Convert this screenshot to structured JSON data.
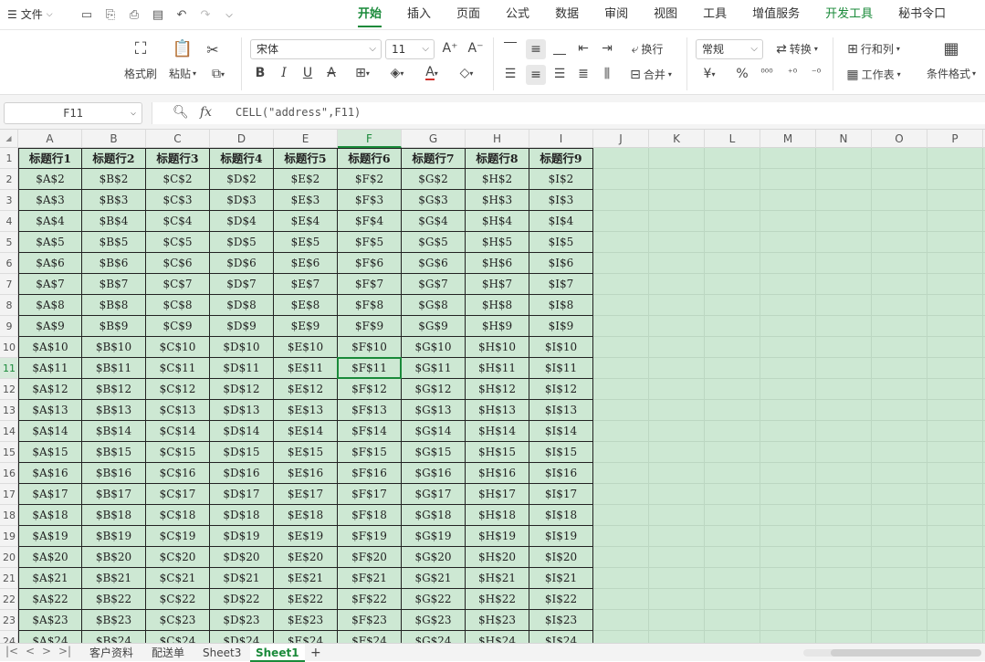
{
  "menu": {
    "file_label": "文件",
    "tabs": [
      {
        "label": "开始",
        "state": "active"
      },
      {
        "label": "插入",
        "state": ""
      },
      {
        "label": "页面",
        "state": ""
      },
      {
        "label": "公式",
        "state": ""
      },
      {
        "label": "数据",
        "state": ""
      },
      {
        "label": "审阅",
        "state": ""
      },
      {
        "label": "视图",
        "state": ""
      },
      {
        "label": "工具",
        "state": ""
      },
      {
        "label": "增值服务",
        "state": ""
      },
      {
        "label": "开发工具",
        "state": "green"
      },
      {
        "label": "秘书令口",
        "state": ""
      }
    ]
  },
  "ribbon": {
    "format_painter": "格式刷",
    "paste": "粘贴",
    "font_name": "宋体",
    "font_size": "11",
    "wrap": "换行",
    "merge": "合并",
    "number_format": "常规",
    "convert": "转换",
    "rows_cols": "行和列",
    "worksheet": "工作表",
    "conditional": "条件格式"
  },
  "formula_bar": {
    "cell_ref": "F11",
    "formula": "CELL(\"address\",F11)"
  },
  "grid": {
    "columns": [
      "A",
      "B",
      "C",
      "D",
      "E",
      "F",
      "G",
      "H",
      "I",
      "J",
      "K",
      "L",
      "M",
      "N",
      "O",
      "P"
    ],
    "selected_col": "F",
    "selected_row": 11,
    "headers": [
      "标题行1",
      "标题行2",
      "标题行3",
      "标题行4",
      "标题行5",
      "标题行6",
      "标题行7",
      "标题行8",
      "标题行9"
    ],
    "data_cols": [
      "A",
      "B",
      "C",
      "D",
      "E",
      "F",
      "G",
      "H",
      "I"
    ],
    "rows": [
      1,
      2,
      3,
      4,
      5,
      6,
      7,
      8,
      9,
      10,
      11,
      12,
      13,
      14,
      15,
      16,
      17,
      18,
      19,
      20,
      21,
      22,
      23,
      24
    ]
  },
  "sheets": {
    "tabs": [
      "客户资料",
      "配送单",
      "Sheet3",
      "Sheet1"
    ],
    "active": "Sheet1",
    "add": "+"
  }
}
